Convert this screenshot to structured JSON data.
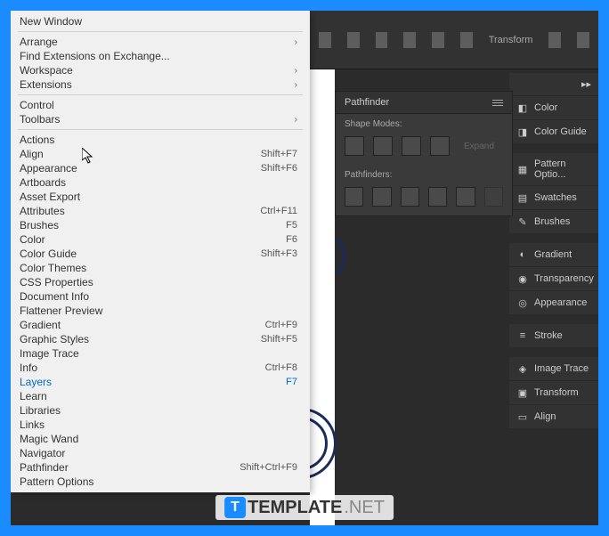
{
  "menu": {
    "new_window": "New Window",
    "arrange": "Arrange",
    "find_ext": "Find Extensions on Exchange...",
    "workspace": "Workspace",
    "extensions": "Extensions",
    "control": "Control",
    "toolbars": "Toolbars",
    "actions": "Actions",
    "align": "Align",
    "align_sc": "Shift+F7",
    "appearance": "Appearance",
    "appearance_sc": "Shift+F6",
    "artboards": "Artboards",
    "asset_export": "Asset Export",
    "attributes": "Attributes",
    "attributes_sc": "Ctrl+F11",
    "brushes": "Brushes",
    "brushes_sc": "F5",
    "color": "Color",
    "color_sc": "F6",
    "color_guide": "Color Guide",
    "color_guide_sc": "Shift+F3",
    "color_themes": "Color Themes",
    "css": "CSS Properties",
    "doc_info": "Document Info",
    "flattener": "Flattener Preview",
    "gradient": "Gradient",
    "gradient_sc": "Ctrl+F9",
    "graphic_styles": "Graphic Styles",
    "graphic_styles_sc": "Shift+F5",
    "image_trace": "Image Trace",
    "info": "Info",
    "info_sc": "Ctrl+F8",
    "layers": "Layers",
    "layers_sc": "F7",
    "learn": "Learn",
    "libraries": "Libraries",
    "links": "Links",
    "magic_wand": "Magic Wand",
    "navigator": "Navigator",
    "pathfinder": "Pathfinder",
    "pathfinder_sc": "Shift+Ctrl+F9",
    "pattern_opt": "Pattern Options"
  },
  "optbar": {
    "transform": "Transform"
  },
  "pathfinder_panel": {
    "title": "Pathfinder",
    "shape_modes": "Shape Modes:",
    "pathfinders": "Pathfinders:",
    "expand": "Expand"
  },
  "rpanel": {
    "color": "Color",
    "color_guide": "Color Guide",
    "pattern_optio": "Pattern Optio...",
    "swatches": "Swatches",
    "brushes": "Brushes",
    "gradient": "Gradient",
    "transparency": "Transparency",
    "appearance": "Appearance",
    "stroke": "Stroke",
    "image_trace": "Image Trace",
    "transform": "Transform",
    "align": "Align"
  },
  "watermark": {
    "t": "T",
    "template": "TEMPLATE",
    "net": ".NET"
  }
}
